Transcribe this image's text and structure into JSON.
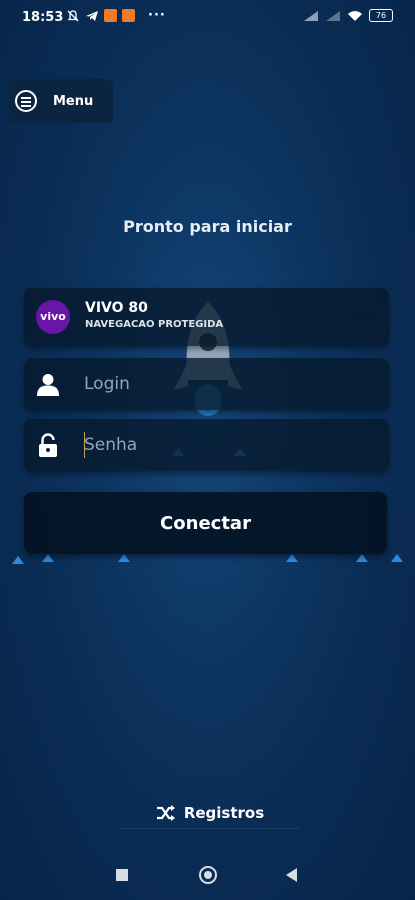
{
  "status_bar": {
    "time": "18:53",
    "battery": "76",
    "more": "···"
  },
  "menu": {
    "label": "Menu"
  },
  "title": "Pronto para iniciar",
  "server": {
    "logo_text": "vivo",
    "name": "VIVO 80",
    "subtitle": "NAVEGACAO PROTEGIDA"
  },
  "login": {
    "placeholder": "Login"
  },
  "password": {
    "placeholder": "Senha"
  },
  "connect_label": "Conectar",
  "registros_label": "Registros",
  "colors": {
    "vivo_purple": "#6a14a8",
    "background": "#0d3663"
  }
}
